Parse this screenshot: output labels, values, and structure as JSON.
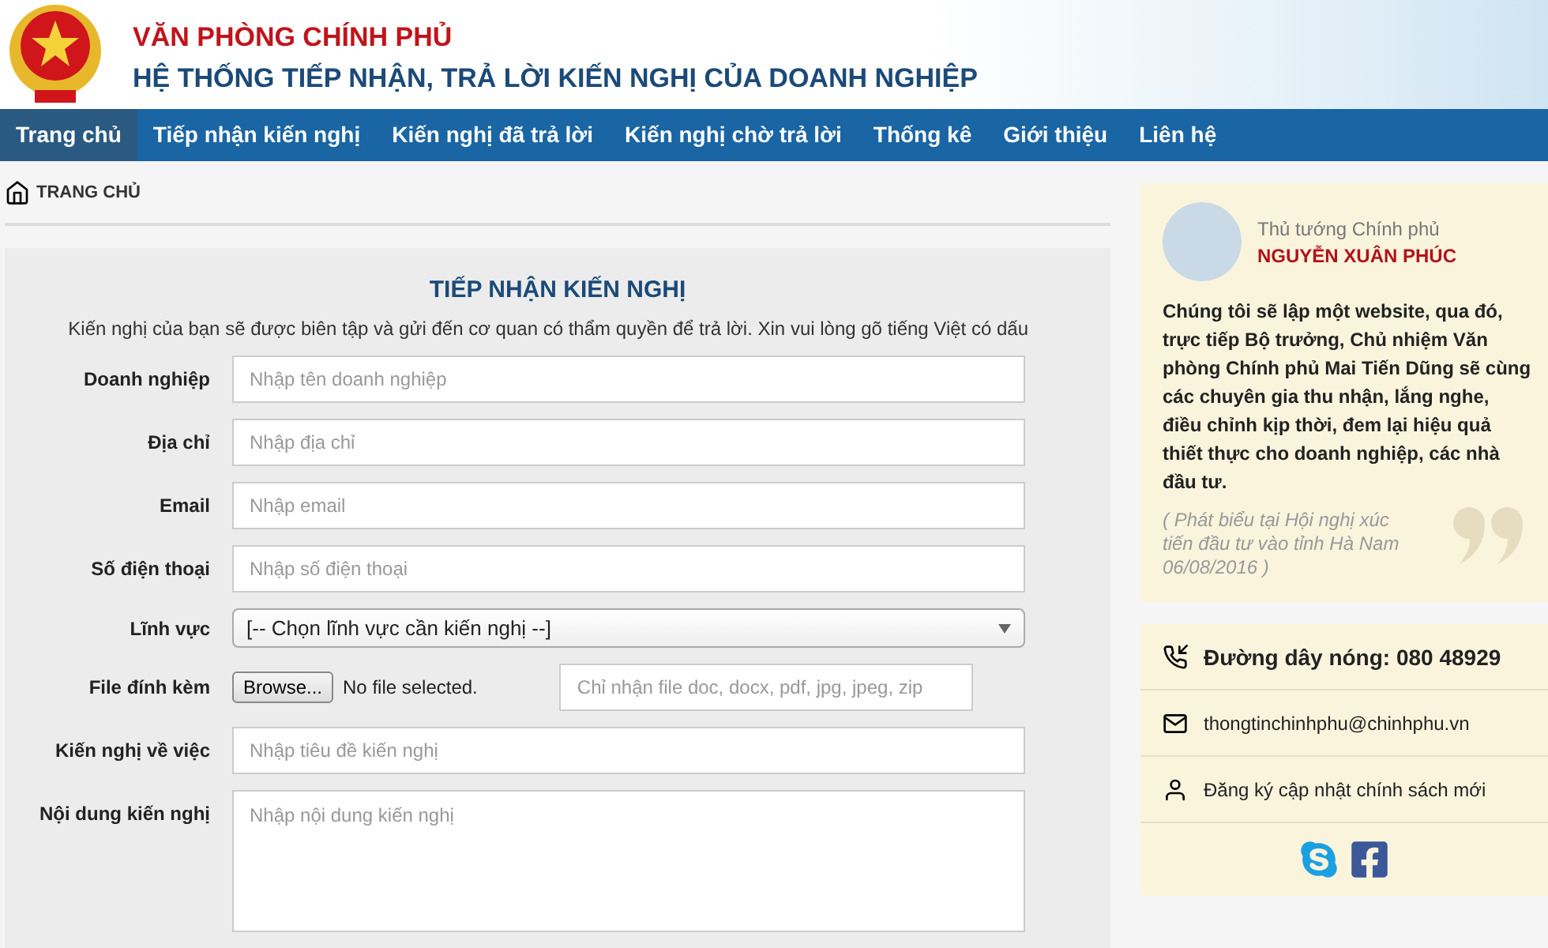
{
  "header": {
    "agency": "VĂN PHÒNG CHÍNH PHỦ",
    "system": "HỆ THỐNG TIẾP NHẬN, TRẢ LỜI KIẾN NGHỊ CỦA DOANH NGHIỆP"
  },
  "nav": [
    {
      "label": "Trang chủ",
      "selected": true
    },
    {
      "label": "Tiếp nhận kiến nghị",
      "selected": false
    },
    {
      "label": "Kiến nghị đã trả lời",
      "selected": false
    },
    {
      "label": "Kiến nghị chờ trả lời",
      "selected": false
    },
    {
      "label": "Thống kê",
      "selected": false
    },
    {
      "label": "Giới thiệu",
      "selected": false
    },
    {
      "label": "Liên hệ",
      "selected": false
    }
  ],
  "breadcrumb": "TRANG CHỦ",
  "form": {
    "title": "TIẾP NHẬN KIẾN NGHỊ",
    "intro": "Kiến nghị của bạn sẽ được biên tập và gửi đến cơ quan có thẩm quyền để trả lời. Xin vui lòng gõ tiếng Việt có dấu",
    "fields": [
      {
        "kind": "text",
        "label": "Doanh nghiệp",
        "placeholder": "Nhập tên doanh nghiệp"
      },
      {
        "kind": "text",
        "label": "Địa chỉ",
        "placeholder": "Nhập địa chỉ"
      },
      {
        "kind": "text",
        "label": "Email",
        "placeholder": "Nhập email"
      },
      {
        "kind": "text",
        "label": "Số điện thoại",
        "placeholder": "Nhập số điện thoại"
      },
      {
        "kind": "select",
        "label": "Lĩnh vực",
        "value": "[-- Chọn lĩnh vực cần kiến nghị --]"
      },
      {
        "kind": "file",
        "label": "File đính kèm",
        "button": "Browse...",
        "status": "No file selected.",
        "placeholder": "Chỉ nhận file doc, docx, pdf, jpg, jpeg, zip"
      },
      {
        "kind": "text",
        "label": "Kiến nghị về việc",
        "placeholder": "Nhập tiêu đề kiến nghị"
      },
      {
        "kind": "textarea",
        "label": "Nội dung kiến nghị",
        "placeholder": "Nhập nội dung kiến nghị"
      }
    ]
  },
  "quote": {
    "role": "Thủ tướng Chính phủ",
    "name": "NGUYỄN XUÂN PHÚC",
    "text": "Chúng tôi sẽ lập một website, qua đó, trực tiếp Bộ trưởng, Chủ nhiệm Văn phòng Chính phủ Mai Tiến Dũng sẽ cùng các chuyên gia thu nhận, lắng nghe, điều chỉnh kịp thời, đem lại hiệu quả thiết thực cho doanh nghiệp, các nhà đầu tư.",
    "source": "( Phát biểu tại Hội nghị xúc tiến đầu tư vào tỉnh Hà Nam 06/08/2016 )"
  },
  "contact": [
    {
      "kind": "hotline",
      "text": "Đường dây nóng: 080 48929"
    },
    {
      "kind": "email",
      "text": "thongtinchinhphu@chinhphu.vn"
    },
    {
      "kind": "subscribe",
      "text": "Đăng ký cập nhật chính sách mới"
    }
  ]
}
